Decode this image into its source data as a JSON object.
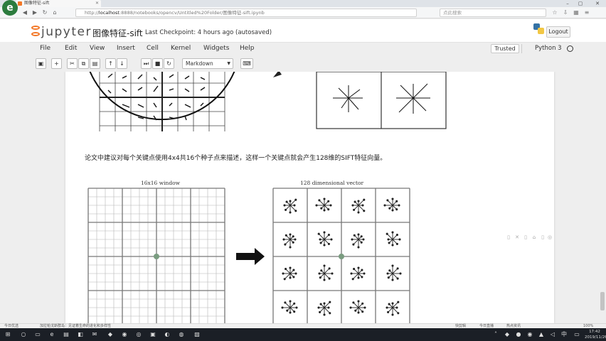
{
  "browser": {
    "tab_title": "图像特征-sift",
    "url_prefix": "http://",
    "url_host": "localhost",
    "url_rest": ":8888/notebooks/opencv/Untitled%20Folder/图像特征-sift.ipynb",
    "search_placeholder": "点此搜索",
    "logo_letter": "e"
  },
  "header": {
    "logo_text": "jupyter",
    "notebook_name": "图像特征-sift",
    "checkpoint": "Last Checkpoint: 4 hours ago (autosaved)",
    "logout": "Logout"
  },
  "menubar": {
    "items": [
      "File",
      "Edit",
      "View",
      "Insert",
      "Cell",
      "Kernel",
      "Widgets",
      "Help"
    ],
    "trusted": "Trusted",
    "kernel": "Python 3"
  },
  "toolbar": {
    "cell_type": "Markdown",
    "buttons": [
      "save-icon",
      "add-icon",
      "cut-icon",
      "copy-icon",
      "paste-icon",
      "move-up-icon",
      "move-down-icon",
      "run-icon",
      "stop-icon",
      "restart-icon",
      "keyboard-icon"
    ]
  },
  "notebook": {
    "paragraph": "论文中建议对每个关键点使用4x4共16个种子点来描述，这样一个关键点就会产生128维的SIFT特征向量。",
    "figure_left_title": "16x16 window",
    "figure_right_title": "128 dimensional vector"
  },
  "statusbar": {
    "left": "今日优选",
    "ticker": "加拉帕戈斯群岛：见证着生命的进化和多样性",
    "items": [
      "快剪辑",
      "今日直播",
      "热点资讯",
      "100%"
    ]
  },
  "taskbar": {
    "time": "17:42",
    "date": "2019/11/26"
  },
  "colors": {
    "jupyter_orange": "#f37726",
    "taskbar": "#1b1f26",
    "grid_line": "#999999"
  }
}
